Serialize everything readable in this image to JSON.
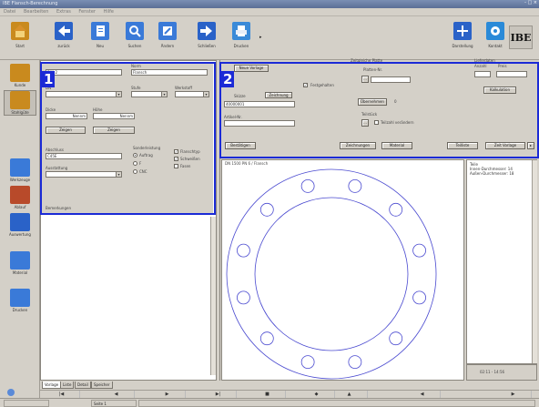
{
  "window": {
    "title": "IBE Flansch-Berechnung",
    "controls": "- □ ×"
  },
  "menu": [
    "Datei",
    "Bearbeiten",
    "Extras",
    "Fenster",
    "Hilfe"
  ],
  "toolbar": {
    "buttons": [
      {
        "label": "Start",
        "color": "#c98a1e"
      },
      {
        "label": "zurück",
        "color": "#2a62c8"
      },
      {
        "label": "Neu",
        "color": "#3a7ad8"
      },
      {
        "label": "Suchen",
        "color": "#3a7ad8"
      },
      {
        "label": "Ändern",
        "color": "#3a7ad8"
      },
      {
        "label": "Schließen",
        "color": "#2a62c8"
      },
      {
        "label": "Drucken",
        "color": "#3a8ad8"
      }
    ],
    "right_buttons": [
      {
        "label": "Darstellung",
        "color": "#2a62c8"
      },
      {
        "label": "Kontakt",
        "color": "#2a8ad8"
      }
    ],
    "logo": "IBE"
  },
  "sidebar": {
    "items": [
      {
        "label": "Kunde",
        "color": "#c98a1e",
        "active": false
      },
      {
        "label": "Stahlgüte",
        "color": "#c98a1e",
        "active": true
      },
      {
        "label": "Werkzeuge",
        "color": "#3a7ad8",
        "active": false
      },
      {
        "label": "Ablauf",
        "color": "#b84a2a",
        "active": false
      },
      {
        "label": "Auswertung",
        "color": "#2a62c8",
        "active": false
      },
      {
        "label": "Material",
        "color": "#3a7ad8",
        "active": false
      },
      {
        "label": "Drucken",
        "color": "#3a7ad8",
        "active": false
      }
    ]
  },
  "form_left": {
    "fields": [
      {
        "label": "Art",
        "value": "DIN 2"
      },
      {
        "label": "Norm",
        "value": "Flansch"
      },
      {
        "label": "DN",
        "value": ""
      },
      {
        "label": "Stufe",
        "value": ""
      },
      {
        "label": "Werkstoff",
        "value": ""
      },
      {
        "label": "Dicke",
        "value": "Nennm"
      },
      {
        "label": "Höhe",
        "value": "Nennm"
      }
    ],
    "buttons": [
      "Zeigen",
      "Zeigen"
    ],
    "lower": {
      "label_a": "Abschluss",
      "value_a": "C45E",
      "label_b": "Ausstattung",
      "value_b": "",
      "options_label": "Sonderleistung",
      "options": [
        {
          "label": "Auftrag",
          "on": true
        },
        {
          "label": "F",
          "on": false
        },
        {
          "label": "CNC",
          "on": false
        }
      ],
      "checks": [
        {
          "label": "Flanschtyp",
          "on": true
        },
        {
          "label": "Schweißen",
          "on": true
        },
        {
          "label": "Fasen",
          "on": false
        }
      ]
    },
    "note_label": "Bemerkungen"
  },
  "left_tabs": [
    "Vorlage",
    "Liste",
    "Detail",
    "Speicher"
  ],
  "form_top": {
    "open_button": "Neue Vorlage",
    "checkbox": {
      "label": "Festgehalten",
      "on": true
    },
    "field1_label": "Skizze",
    "field1_value": "40000001",
    "field1_btn": "Zeichnung",
    "field2_label": "Artikel-Nr.",
    "field2_value": "",
    "group1_label": "Zeitgleiche Platte",
    "group1_field_label": "Platten-Nr.",
    "group1_field_value": "",
    "group1_btn": "Übernehmen",
    "group1_count": "0",
    "group2_label": "Teilstück",
    "group2_check": "Teilzahl verändern",
    "right_label": "Lieferdaten",
    "right_f1": "Anzahl",
    "right_f2": "Preis",
    "right_btn": "Kalkulation",
    "bottom_buttons": [
      "Bestätigen",
      "Zeichnungen",
      "Material",
      "Teilliste",
      "Zeit Vorlage"
    ]
  },
  "drawing": {
    "header": "DN 1500 PN 6 / Flansch",
    "bolt_holes": 12
  },
  "info_list": {
    "lines": [
      "Teile",
      "Innen-Durchmesser: 14",
      "Außen-Durchmesser: 18"
    ]
  },
  "time": "02:11 - 14:56",
  "navbar": [
    "|◀",
    "◀",
    "▶",
    "▶|",
    "■",
    "◆",
    "▲",
    "◀",
    "▶"
  ],
  "status": {
    "left": "",
    "cell1": "Seite 1",
    "cell2": ""
  },
  "markers": [
    {
      "num": "1"
    },
    {
      "num": "2"
    }
  ],
  "colors": {
    "marker": "#1b2ad6",
    "circle": "#4a4ad0"
  }
}
